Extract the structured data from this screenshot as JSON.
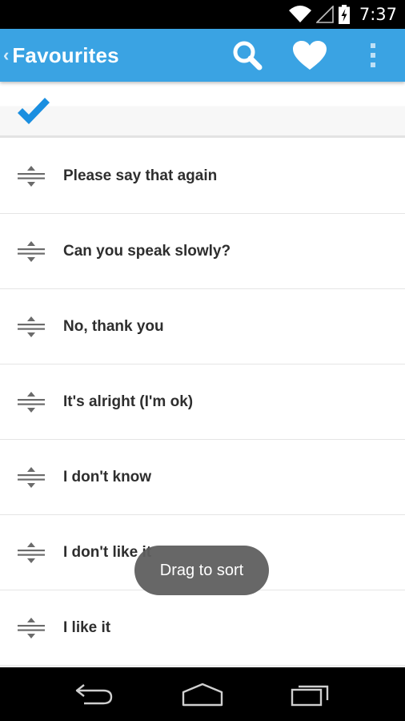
{
  "status_bar": {
    "time": "7:37",
    "icons": [
      "wifi-icon",
      "signal-icon",
      "battery-charging-icon"
    ]
  },
  "action_bar": {
    "back_icon": "chevron-left-icon",
    "title": "Favourites",
    "actions": [
      {
        "name": "search",
        "icon": "search-icon"
      },
      {
        "name": "favourites",
        "icon": "heart-icon"
      },
      {
        "name": "overflow-menu",
        "icon": "more-vertical-icon"
      }
    ]
  },
  "selection": {
    "icon": "checkmark-icon"
  },
  "list": {
    "handle_icon": "drag-handle-icon",
    "items": [
      {
        "text": "Please say that again"
      },
      {
        "text": "Can you speak slowly?"
      },
      {
        "text": "No, thank you"
      },
      {
        "text": "It's alright (I'm ok)"
      },
      {
        "text": "I don't know"
      },
      {
        "text": "I don't like it"
      },
      {
        "text": "I like it"
      }
    ]
  },
  "toast": {
    "text": "Drag to sort"
  },
  "nav_bar": {
    "buttons": [
      {
        "name": "back",
        "icon": "back-arrow-icon"
      },
      {
        "name": "home",
        "icon": "home-icon"
      },
      {
        "name": "recents",
        "icon": "recent-apps-icon"
      }
    ]
  },
  "colors": {
    "action_bar": "#3aa3e3",
    "accent": "#1b8fe0",
    "text_primary": "#2e2e2e",
    "toast_bg": "#5f5f5f"
  }
}
